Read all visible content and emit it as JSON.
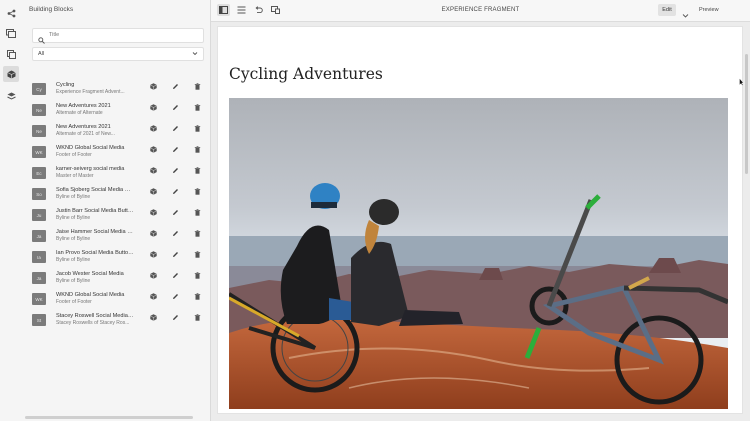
{
  "panel": {
    "title": "Building Blocks",
    "search_placeholder": "Title",
    "filter_value": "All"
  },
  "items": [
    {
      "thumb": "Cy",
      "name": "Cycling",
      "sub": "Experience Fragment Advent..."
    },
    {
      "thumb": "Ne",
      "name": "New Adventures 2021",
      "sub": "Alternate of Alternate"
    },
    {
      "thumb": "Ne",
      "name": "New Adventures 2021",
      "sub": "Alternate of 2021 of New..."
    },
    {
      "thumb": "WK",
      "name": "WKND Global Social Media",
      "sub": "Footer of Footer"
    },
    {
      "thumb": "Ec",
      "name": "karner-seiverg social media",
      "sub": "Master of Master"
    },
    {
      "thumb": "So",
      "name": "Sofia Sjoberg Social Media Bu...",
      "sub": "Byline of Byline"
    },
    {
      "thumb": "Ju",
      "name": "Justin Barr Social Media Butto...",
      "sub": "Byline of Byline"
    },
    {
      "thumb": "Ja",
      "name": "Jaise Hammer Social Media Bu...",
      "sub": "Byline of Byline"
    },
    {
      "thumb": "Ia",
      "name": "Ian Provo Social Media Buttons",
      "sub": "Byline of Byline"
    },
    {
      "thumb": "Ja",
      "name": "Jacob Wester Social Media",
      "sub": "Byline of Byline"
    },
    {
      "thumb": "WK",
      "name": "WKND Global Social Media",
      "sub": "Footer of Footer"
    },
    {
      "thumb": "St",
      "name": "Stacey Roswell Social Media ...",
      "sub": "Stacey Roswells of Stacey Ros..."
    }
  ],
  "toolbar": {
    "title": "EXPERIENCE FRAGMENT",
    "edit_label": "Edit",
    "preview_label": "Preview"
  },
  "page": {
    "title": "Cycling Adventures"
  },
  "colors": {
    "rail_bg": "#f5f5f5",
    "panel_bg": "#f5f5f5",
    "thumb_bg": "#7b7b7b",
    "canvas_bg": "#ffffff",
    "workspace_bg": "#ececec"
  },
  "icons": {
    "rail": [
      "component-browser-icon",
      "assets-icon",
      "components-icon",
      "content-tree-icon"
    ],
    "item_actions": [
      "box-icon",
      "pencil-icon",
      "trash-icon"
    ],
    "toolbar": [
      "side-panel-toggle-icon",
      "properties-icon",
      "undo-icon",
      "emulator-icon",
      "chevron-down-icon"
    ]
  }
}
